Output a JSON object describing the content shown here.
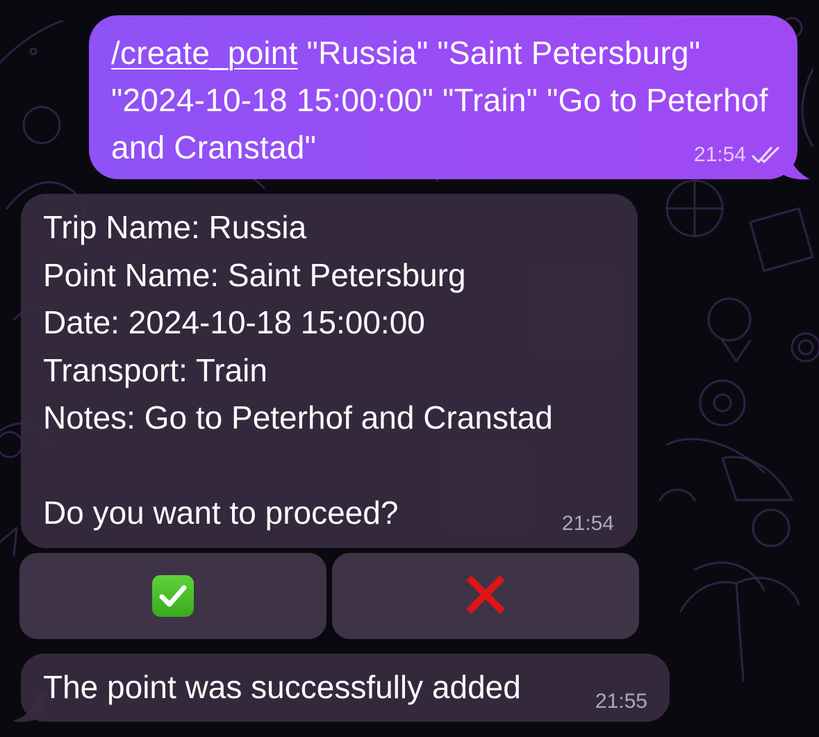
{
  "outgoing": {
    "command": "/create_point",
    "text": " \"Russia\" \"Saint Petersburg\" \"2024-10-18 15:00:00\" \"Train\" \"Go to Peterhof and Cranstad\"",
    "time": "21:54",
    "status_icon": "double-check-icon"
  },
  "incoming": {
    "lines": [
      "Trip Name: Russia",
      "Point Name: Saint Petersburg",
      "Date: 2024-10-18 15:00:00",
      "Transport: Train",
      "Notes: Go to Peterhof and Cranstad"
    ],
    "question": "Do you want to proceed?",
    "time": "21:54"
  },
  "keyboard": {
    "confirm_icon": "check-mark-button-emoji",
    "cancel_icon": "cross-mark-emoji"
  },
  "incoming2": {
    "text": "The point was successfully added",
    "time": "21:55"
  },
  "colors": {
    "outgoing_bubble": "#9b4cf5",
    "incoming_bubble": "#382c40",
    "background": "#0b0910"
  }
}
